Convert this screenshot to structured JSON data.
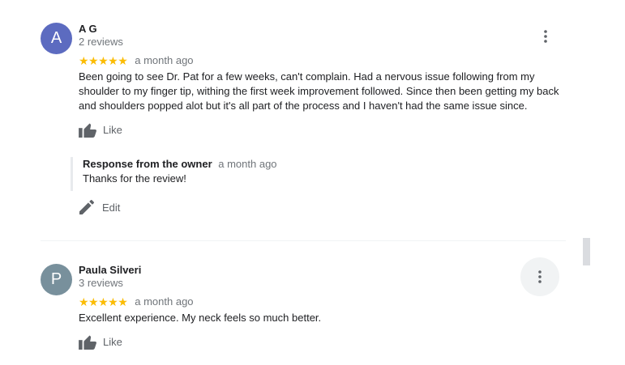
{
  "reviews": [
    {
      "author": "A G",
      "avatar_letter": "A",
      "avatar_color": "#5c6bc0",
      "meta": "2 reviews",
      "stars": "★★★★★",
      "date": "a month ago",
      "text": "Been going to see Dr. Pat for a few weeks, can't complain. Had a nervous issue following from my shoulder to my finger tip, withing the first week improvement followed. Since then been getting my back and shoulders popped alot but it's all part of the process and I haven't had the same issue since.",
      "like_label": "Like",
      "owner_response": {
        "title": "Response from the owner",
        "date": "a month ago",
        "text": "Thanks for the review!",
        "edit_label": "Edit"
      }
    },
    {
      "author": "Paula Silveri",
      "avatar_letter": "P",
      "avatar_color": "#78909c",
      "meta": "3 reviews",
      "stars": "★★★★★",
      "date": "a month ago",
      "text": "Excellent experience.  My neck feels so much better.",
      "like_label": "Like"
    }
  ],
  "icons": {
    "more": "more-vert-icon",
    "like": "thumb-up-icon",
    "edit": "pencil-icon"
  },
  "colors": {
    "star": "#fbbc04",
    "secondary_text": "#70757a",
    "icon": "#5f6368"
  }
}
